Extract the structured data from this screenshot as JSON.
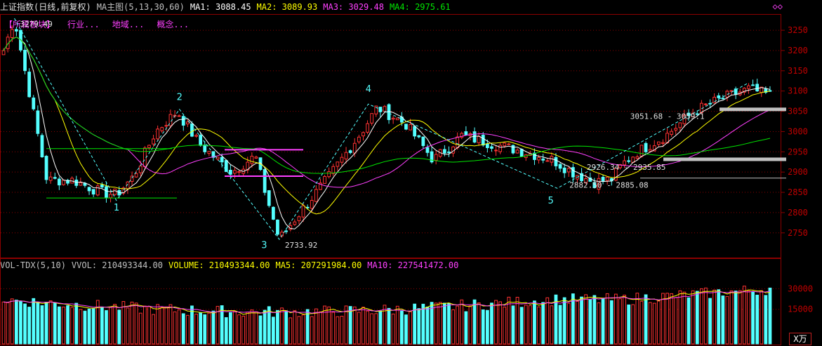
{
  "header": {
    "title": "上证指数(日线,前复权)",
    "indicator": "MA主图(5,13,30,60)",
    "ma1": "MA1: 3088.45",
    "ma2": "MA2: 3089.93",
    "ma3": "MA3: 3029.48",
    "ma4": "MA4: 2975.61",
    "corner_icon": "diamond-icon"
  },
  "sectors": [
    "【所属板块】",
    "行业...",
    "地域...",
    "概念..."
  ],
  "volume_header": {
    "name": "VOL-TDX(5,10)",
    "vvol": "VVOL: 210493344.00",
    "volume": "VOLUME: 210493344.00",
    "ma5": "MA5: 207291984.00",
    "ma10": "MA10: 227541472.00"
  },
  "volume_unit": "X万",
  "colors": {
    "up": "#ff3232",
    "down": "#54ffff",
    "ma1": "#ffffff",
    "ma2": "#ffff00",
    "ma3": "#ff40ff",
    "ma4": "#00e600",
    "grid": "#8c0000"
  },
  "chart_data": [
    {
      "type": "candlestick",
      "title": "上证指数(日线,前复权)",
      "y_ticks": [
        2750,
        2800,
        2850,
        2900,
        2950,
        3000,
        3050,
        3100,
        3150,
        3200,
        3250
      ],
      "ylim": [
        2715,
        3290
      ],
      "bar_count": 180,
      "series_ma": [
        "MA1",
        "MA2",
        "MA3",
        "MA4"
      ],
      "price_path": [
        [
          0,
          3200
        ],
        [
          5,
          3279.49
        ],
        [
          14,
          3040
        ],
        [
          20,
          2880
        ],
        [
          32,
          2880
        ],
        [
          45,
          2850
        ],
        [
          52,
          2845
        ],
        [
          60,
          2890
        ],
        [
          70,
          3000
        ],
        [
          80,
          3050
        ],
        [
          90,
          2970
        ],
        [
          105,
          2900
        ],
        [
          116,
          2940
        ],
        [
          120,
          2860
        ],
        [
          127,
          2733.92
        ],
        [
          135,
          2790
        ],
        [
          150,
          2890
        ],
        [
          165,
          3000
        ],
        [
          172,
          3060
        ],
        [
          185,
          3020
        ],
        [
          198,
          2930
        ],
        [
          211,
          2990
        ],
        [
          225,
          2970
        ],
        [
          240,
          2950
        ],
        [
          253,
          2930
        ],
        [
          262,
          2900
        ],
        [
          272,
          2875
        ],
        [
          280,
          2882.5
        ],
        [
          285,
          2920
        ],
        [
          292,
          2950
        ],
        [
          305,
          2990
        ],
        [
          318,
          3050
        ],
        [
          330,
          3080
        ],
        [
          343,
          3105
        ],
        [
          353,
          3090
        ]
      ],
      "wave_labels": [
        {
          "text": "1",
          "i": 52,
          "value": 2805
        },
        {
          "text": "2",
          "i": 81,
          "value": 3078
        },
        {
          "text": "3",
          "i": 120,
          "value": 2712
        },
        {
          "text": "4",
          "i": 168,
          "value": 3098
        },
        {
          "text": "5",
          "i": 252,
          "value": 2822
        }
      ],
      "price_annotations": [
        {
          "text": "3279.49",
          "i": 5,
          "value": 3279.49
        },
        {
          "text": "2733.92",
          "i": 127,
          "value": 2733.92
        },
        {
          "text": "2882.50 - 2885.08",
          "i": 258,
          "value": 2882.5
        },
        {
          "text": "2926.34 - 2935.85",
          "i": 266,
          "value": 2926.34
        },
        {
          "text": "3051.68 - 3059.1",
          "i": 286,
          "value": 3051.68
        }
      ]
    },
    {
      "type": "bar",
      "title": "VOL-TDX(5,10)",
      "y_ticks": [
        15000,
        30000
      ],
      "ylim": [
        0,
        42000
      ],
      "unit": "X万",
      "series": [
        {
          "name": "MA5"
        },
        {
          "name": "MA10"
        }
      ]
    }
  ]
}
